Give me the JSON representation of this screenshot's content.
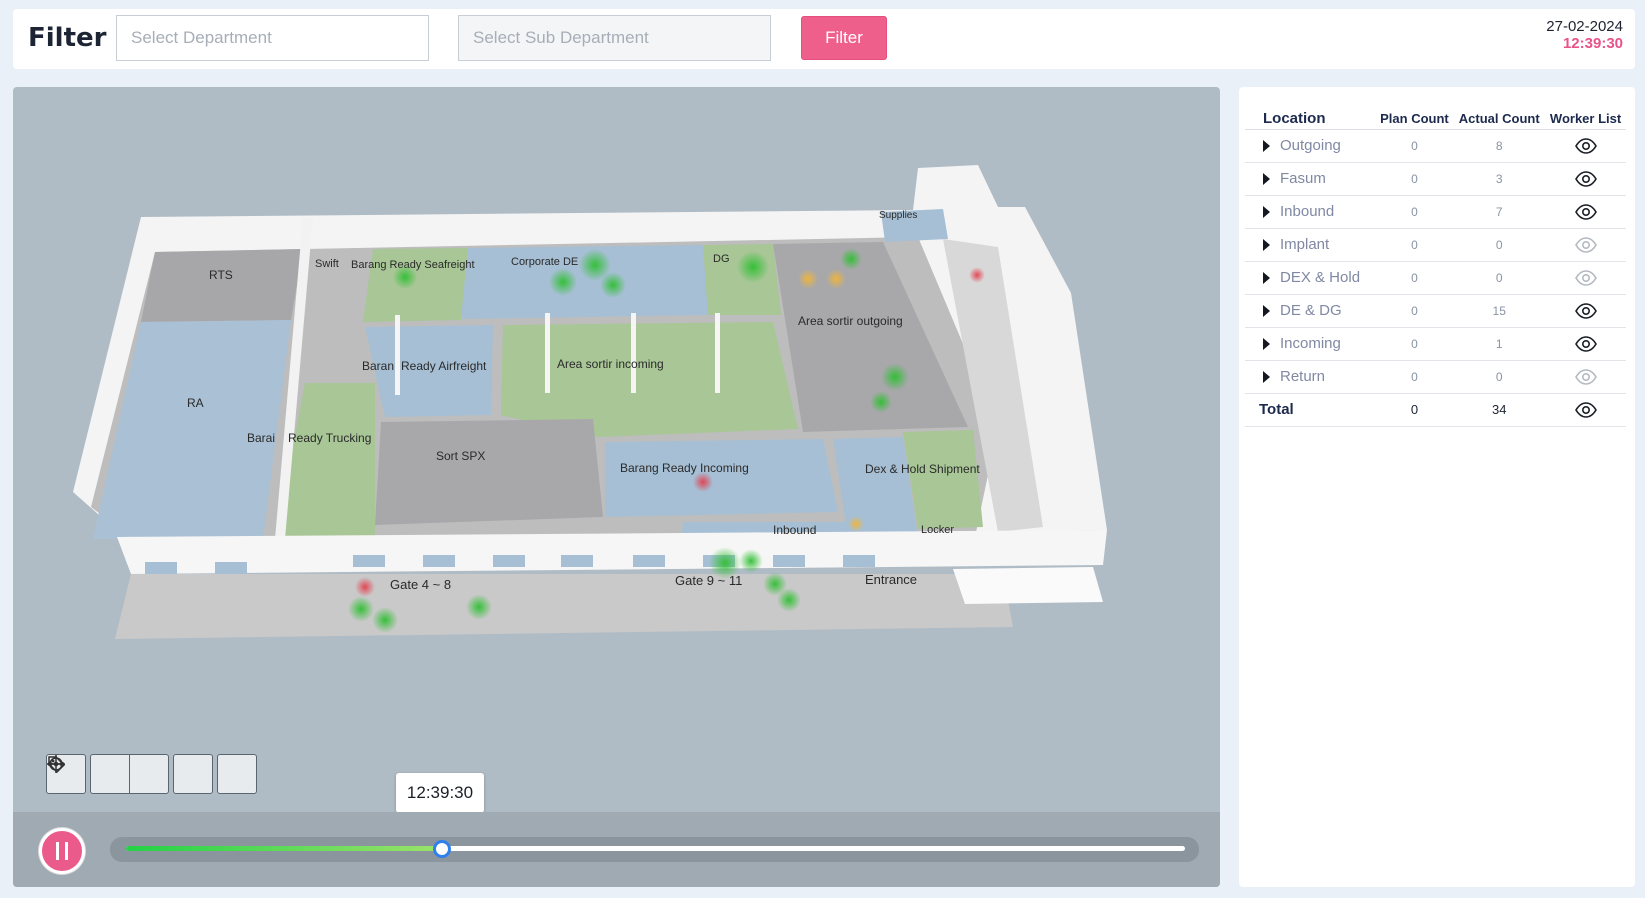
{
  "header": {
    "title": "Filter",
    "department_placeholder": "Select Department",
    "sub_department_placeholder": "Select Sub Department",
    "filter_button": "Filter",
    "date": "27-02-2024",
    "time": "12:39:30"
  },
  "map": {
    "zones": [
      "RTS",
      "Swift",
      "Barang Ready Seafreight",
      "Corporate DE",
      "DG",
      "Supplies",
      "RA",
      "Baran",
      "Ready Airfreight",
      "Area sortir incoming",
      "Area sortir outgoing",
      "Barai",
      "Ready Trucking",
      "Sort SPX",
      "Barang Ready Incoming",
      "Dex & Hold Shipment",
      "Inbound",
      "Locker",
      "Gate 4 ~ 8",
      "Gate 9 ~ 11",
      "Entrance"
    ],
    "tools": [
      "target-icon",
      "zoom-out-icon",
      "zoom-in-icon",
      "tag-icon",
      "more-icon"
    ]
  },
  "player": {
    "tooltip": "12:39:30",
    "progress": 0.298
  },
  "table": {
    "headers": {
      "location": "Location",
      "plan": "Plan Count",
      "actual": "Actual Count",
      "workers": "Worker List"
    },
    "rows": [
      {
        "location": "Outgoing",
        "plan": "0",
        "actual": "8",
        "active": true
      },
      {
        "location": "Fasum",
        "plan": "0",
        "actual": "3",
        "active": true
      },
      {
        "location": "Inbound",
        "plan": "0",
        "actual": "7",
        "active": true
      },
      {
        "location": "Implant",
        "plan": "0",
        "actual": "0",
        "active": false
      },
      {
        "location": "DEX & Hold",
        "plan": "0",
        "actual": "0",
        "active": false
      },
      {
        "location": "DE & DG",
        "plan": "0",
        "actual": "15",
        "active": true
      },
      {
        "location": "Incoming",
        "plan": "0",
        "actual": "1",
        "active": true
      },
      {
        "location": "Return",
        "plan": "0",
        "actual": "0",
        "active": false
      }
    ],
    "total": {
      "label": "Total",
      "plan": "0",
      "actual": "34"
    }
  },
  "colors": {
    "accent": "#ee5f8b",
    "progress": "#23d147",
    "thumb": "#2f80ed"
  }
}
